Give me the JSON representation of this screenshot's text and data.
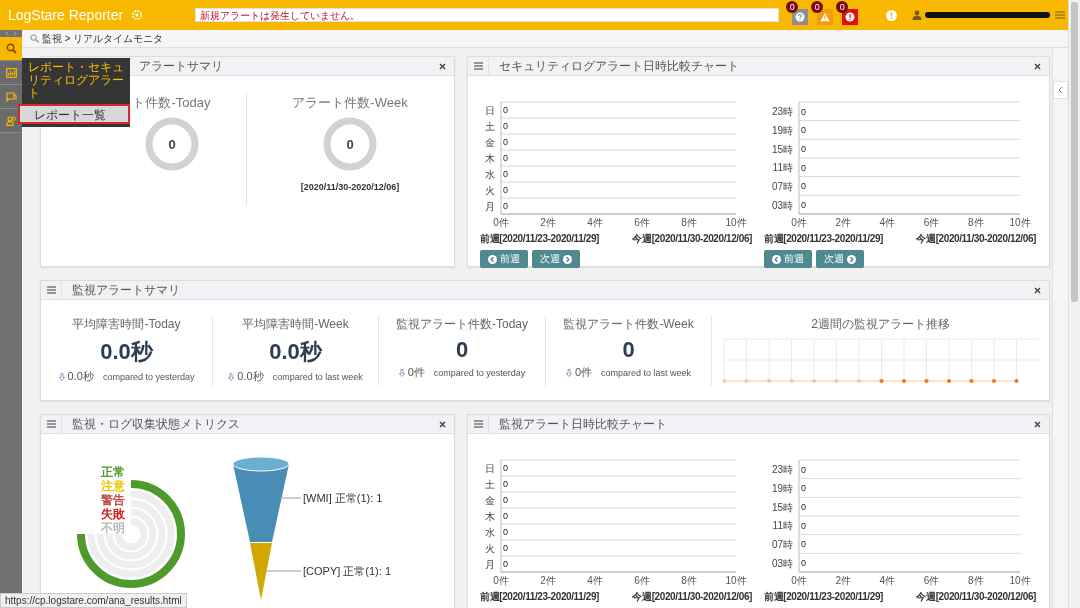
{
  "header": {
    "logo": "LogStare Reporter",
    "notice": "新規アラートは発生していません。",
    "status_icons": [
      {
        "kind": "question",
        "count": "0",
        "color": "#8f8f8f"
      },
      {
        "kind": "warning",
        "count": "0",
        "color": "#f39c12"
      },
      {
        "kind": "error",
        "count": "0",
        "color": "#e01010"
      }
    ]
  },
  "sidebar": {
    "items": [
      {
        "kind": "search",
        "selected": true
      },
      {
        "kind": "report",
        "selected": false
      },
      {
        "kind": "book",
        "selected": false
      },
      {
        "kind": "users",
        "selected": false
      }
    ]
  },
  "flyout_menu": {
    "title": "レポート・セキュリティログアラート",
    "items": [
      {
        "label": "レポート一覧",
        "selected": true
      }
    ]
  },
  "breadcrumb": "監視 > リアルタイムモニタ",
  "security_summary": {
    "title": "アラートサマリ",
    "gauges": [
      {
        "label": "ト件数-Today",
        "value": "0"
      },
      {
        "label": "アラート件数-Week",
        "value": "0",
        "period": "[2020/11/30-2020/12/06]"
      }
    ]
  },
  "security_chart": {
    "title": "セキュリティログアラート日時比較チャート",
    "charts": [
      {
        "chart_data": {
          "type": "bar",
          "orientation": "horizontal",
          "categories": [
            "日",
            "土",
            "金",
            "木",
            "水",
            "火",
            "月"
          ],
          "values": [
            0,
            0,
            0,
            0,
            0,
            0,
            0
          ],
          "xlim": [
            0,
            10
          ],
          "xticks": [
            {
              "value": 0,
              "label": "0件"
            },
            {
              "value": 2,
              "label": "2件"
            },
            {
              "value": 4,
              "label": "4件"
            },
            {
              "value": 6,
              "label": "6件"
            },
            {
              "value": 8,
              "label": "8件"
            },
            {
              "value": 10,
              "label": "10件"
            }
          ],
          "grid": true,
          "data_labels": true
        },
        "prev_week": "前週[2020/11/23-2020/11/29]",
        "this_week": "今週[2020/11/30-2020/12/06]",
        "buttons": [
          {
            "kind": "prev",
            "label": "前週"
          },
          {
            "kind": "next",
            "label": "次週"
          }
        ]
      },
      {
        "chart_data": {
          "type": "bar",
          "orientation": "horizontal",
          "categories": [
            "23時",
            "19時",
            "15時",
            "11時",
            "07時",
            "03時"
          ],
          "values": [
            0,
            0,
            0,
            0,
            0,
            0
          ],
          "xlim": [
            0,
            10
          ],
          "xticks": [
            {
              "value": 0,
              "label": "0件"
            },
            {
              "value": 2,
              "label": "2件"
            },
            {
              "value": 4,
              "label": "4件"
            },
            {
              "value": 6,
              "label": "6件"
            },
            {
              "value": 8,
              "label": "8件"
            },
            {
              "value": 10,
              "label": "10件"
            }
          ],
          "grid": true,
          "data_labels": true
        },
        "prev_week": "前週[2020/11/23-2020/11/29]",
        "this_week": "今週[2020/11/30-2020/12/06]",
        "buttons": [
          {
            "kind": "prev",
            "label": "前週"
          },
          {
            "kind": "next",
            "label": "次週"
          }
        ]
      }
    ]
  },
  "monitor_summary": {
    "title": "監視アラートサマリ",
    "stats": [
      {
        "label": "平均障害時間-Today",
        "value": "0.0秒",
        "delta": "0.0秒",
        "comparison": "compared to yesterday"
      },
      {
        "label": "平均障害時間-Week",
        "value": "0.0秒",
        "delta": "0.0秒",
        "comparison": "compared to last week"
      },
      {
        "label": "監視アラート件数-Today",
        "value": "0",
        "delta": "0件",
        "comparison": "compared to yesterday"
      },
      {
        "label": "監視アラート件数-Week",
        "value": "0",
        "delta": "0件",
        "comparison": "compared to last week"
      }
    ],
    "trend": {
      "title": "2週間の監視アラート推移"
    }
  },
  "metrics": {
    "title": "監視・ログ収集状態メトリクス",
    "legend": [
      {
        "label": "正常",
        "color": "#4f9a2c"
      },
      {
        "label": "注意",
        "color": "#e8c800"
      },
      {
        "label": "警告",
        "color": "#c0504d"
      },
      {
        "label": "失敗",
        "color": "#cc1a1a"
      },
      {
        "label": "不明",
        "color": "#b8b8b8"
      }
    ],
    "funnel": [
      {
        "label": "[WMI] 正常(1): 1",
        "color": "#4a8db4"
      },
      {
        "label": "[COPY] 正常(1): 1",
        "color": "#d2a800"
      }
    ]
  },
  "monitor_chart": {
    "title": "監視アラート日時比較チャート",
    "charts": [
      {
        "chart_data": {
          "type": "bar",
          "orientation": "horizontal",
          "categories": [
            "日",
            "土",
            "金",
            "木",
            "水",
            "火",
            "月"
          ],
          "values": [
            0,
            0,
            0,
            0,
            0,
            0,
            0
          ],
          "xlim": [
            0,
            10
          ],
          "xticks": [
            {
              "value": 0,
              "label": "0件"
            },
            {
              "value": 2,
              "label": "2件"
            },
            {
              "value": 4,
              "label": "4件"
            },
            {
              "value": 6,
              "label": "6件"
            },
            {
              "value": 8,
              "label": "8件"
            },
            {
              "value": 10,
              "label": "10件"
            }
          ],
          "grid": true,
          "data_labels": true
        },
        "prev_week": "前週[2020/11/23-2020/11/29]",
        "this_week": "今週[2020/11/30-2020/12/06]"
      },
      {
        "chart_data": {
          "type": "bar",
          "orientation": "horizontal",
          "categories": [
            "23時",
            "19時",
            "15時",
            "11時",
            "07時",
            "03時"
          ],
          "values": [
            0,
            0,
            0,
            0,
            0,
            0
          ],
          "xlim": [
            0,
            10
          ],
          "xticks": [
            {
              "value": 0,
              "label": "0件"
            },
            {
              "value": 2,
              "label": "2件"
            },
            {
              "value": 4,
              "label": "4件"
            },
            {
              "value": 6,
              "label": "6件"
            },
            {
              "value": 8,
              "label": "8件"
            },
            {
              "value": 10,
              "label": "10件"
            }
          ],
          "grid": true,
          "data_labels": true
        },
        "prev_week": "前週[2020/11/23-2020/11/29]",
        "this_week": "今週[2020/11/30-2020/12/06]"
      }
    ]
  },
  "status_bar": {
    "url": "https://cp.logstare.com/ana_results.html"
  }
}
